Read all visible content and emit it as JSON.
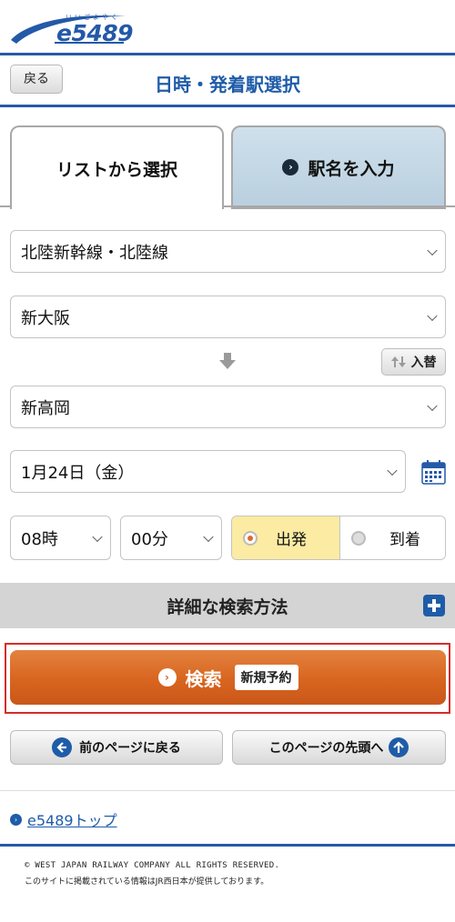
{
  "header": {
    "logo_text": "e5489",
    "logo_ruby": "いいごよやく",
    "brand_color": "#2459a8"
  },
  "title_bar": {
    "back_label": "戻る",
    "title": "日時・発着駅選択"
  },
  "tabs": [
    {
      "label": "リストから選択",
      "active": true
    },
    {
      "label": "駅名を入力",
      "active": false
    }
  ],
  "form": {
    "line": "北陸新幹線・北陸線",
    "from_station": "新大阪",
    "swap_label": "入替",
    "to_station": "新高岡",
    "date": "1月24日（金）",
    "hour": "08時",
    "minute": "00分",
    "depart_label": "出発",
    "arrive_label": "到着",
    "selected": "出発"
  },
  "detail_search": {
    "label": "詳細な検索方法"
  },
  "search_button": {
    "label": "検索",
    "badge": "新規予約",
    "color": "#d8651f"
  },
  "nav": {
    "prev_label": "前のページに戻る",
    "top_label": "このページの先頭へ"
  },
  "footer": {
    "top_link": "e5489トップ",
    "copyright": "© WEST JAPAN RAILWAY COMPANY ALL RIGHTS RESERVED.",
    "provider_note": "このサイトに掲載されている情報はJR西日本が提供しております。"
  }
}
